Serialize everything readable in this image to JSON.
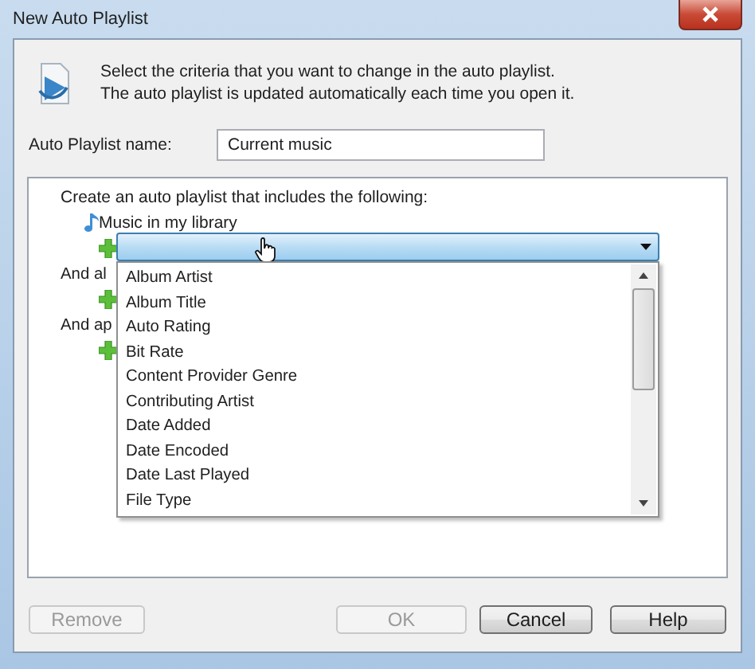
{
  "window": {
    "title": "New Auto Playlist"
  },
  "intro": [
    "Select the criteria that you want to change in the auto playlist.",
    "The auto playlist is updated automatically each time you open it."
  ],
  "name_field": {
    "label": "Auto Playlist name:",
    "value": "Current music"
  },
  "criteria": {
    "heading": "Create an auto playlist that includes the following:",
    "source": "Music in my library",
    "groups": [
      "And al",
      "And ap"
    ]
  },
  "dropdown": {
    "expanded": true,
    "options": [
      "Album Artist",
      "Album Title",
      "Auto Rating",
      "Bit Rate",
      "Content Provider Genre",
      "Contributing Artist",
      "Date Added",
      "Date Encoded",
      "Date Last Played",
      "File Type"
    ]
  },
  "buttons": [
    {
      "label": "Remove",
      "disabled": true
    },
    {
      "label": "OK",
      "disabled": true
    },
    {
      "label": "Cancel",
      "disabled": false
    },
    {
      "label": "Help",
      "disabled": false
    }
  ]
}
